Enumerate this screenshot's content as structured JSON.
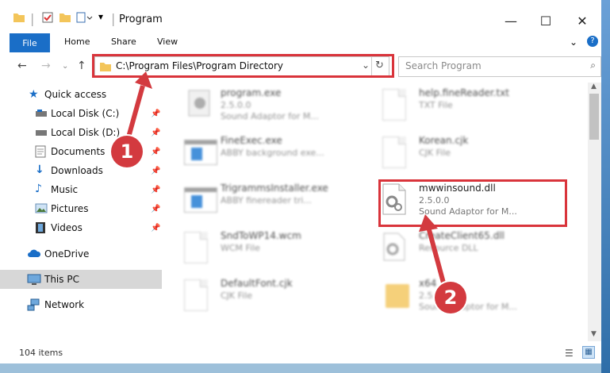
{
  "window": {
    "title": "Program"
  },
  "ribbon": {
    "file": "File",
    "home": "Home",
    "share": "Share",
    "view": "View",
    "help": "?"
  },
  "navigation": {
    "address": "C:\\Program Files\\Program Directory",
    "search_placeholder": "Search Program"
  },
  "sidebar": {
    "items": [
      {
        "label": "Quick access"
      },
      {
        "label": "Local Disk (C:)"
      },
      {
        "label": "Local Disk (D:)"
      },
      {
        "label": "Documents"
      },
      {
        "label": "Downloads"
      },
      {
        "label": "Music"
      },
      {
        "label": "Pictures"
      },
      {
        "label": "Videos"
      },
      {
        "label": "OneDrive"
      },
      {
        "label": "This PC"
      },
      {
        "label": "Network"
      }
    ]
  },
  "files": {
    "left": [
      {
        "name": "program.exe",
        "line1": "2.5.0.0",
        "line2": "Sound Adaptor for M..."
      },
      {
        "name": "FineExec.exe",
        "line1": "ABBY background exe...",
        "line2": ""
      },
      {
        "name": "TrigrammsInstaller.exe",
        "line1": "ABBY finereader tri...",
        "line2": ""
      },
      {
        "name": "SndToWP14.wcm",
        "line1": "WCM File",
        "line2": ""
      },
      {
        "name": "DefaultFont.cjk",
        "line1": "CJK File",
        "line2": ""
      }
    ],
    "right": [
      {
        "name": "help.fineReader.txt",
        "line1": "TXT File",
        "line2": ""
      },
      {
        "name": "Korean.cjk",
        "line1": "CJK File",
        "line2": ""
      },
      {
        "name": "mwwinsound.dll",
        "line1": "2.5.0.0",
        "line2": "Sound Adaptor for M..."
      },
      {
        "name": "CreateClient65.dll",
        "line1": "Resource DLL",
        "line2": ""
      },
      {
        "name": "x64",
        "line1": "2.5.0.0",
        "line2": "Sound Adaptor for M..."
      }
    ]
  },
  "status": {
    "items": "104 items"
  },
  "callouts": {
    "one": "1",
    "two": "2"
  },
  "colors": {
    "accent": "#1a6ec7",
    "highlight": "#d9343b",
    "selected": "#d7d7d7"
  }
}
